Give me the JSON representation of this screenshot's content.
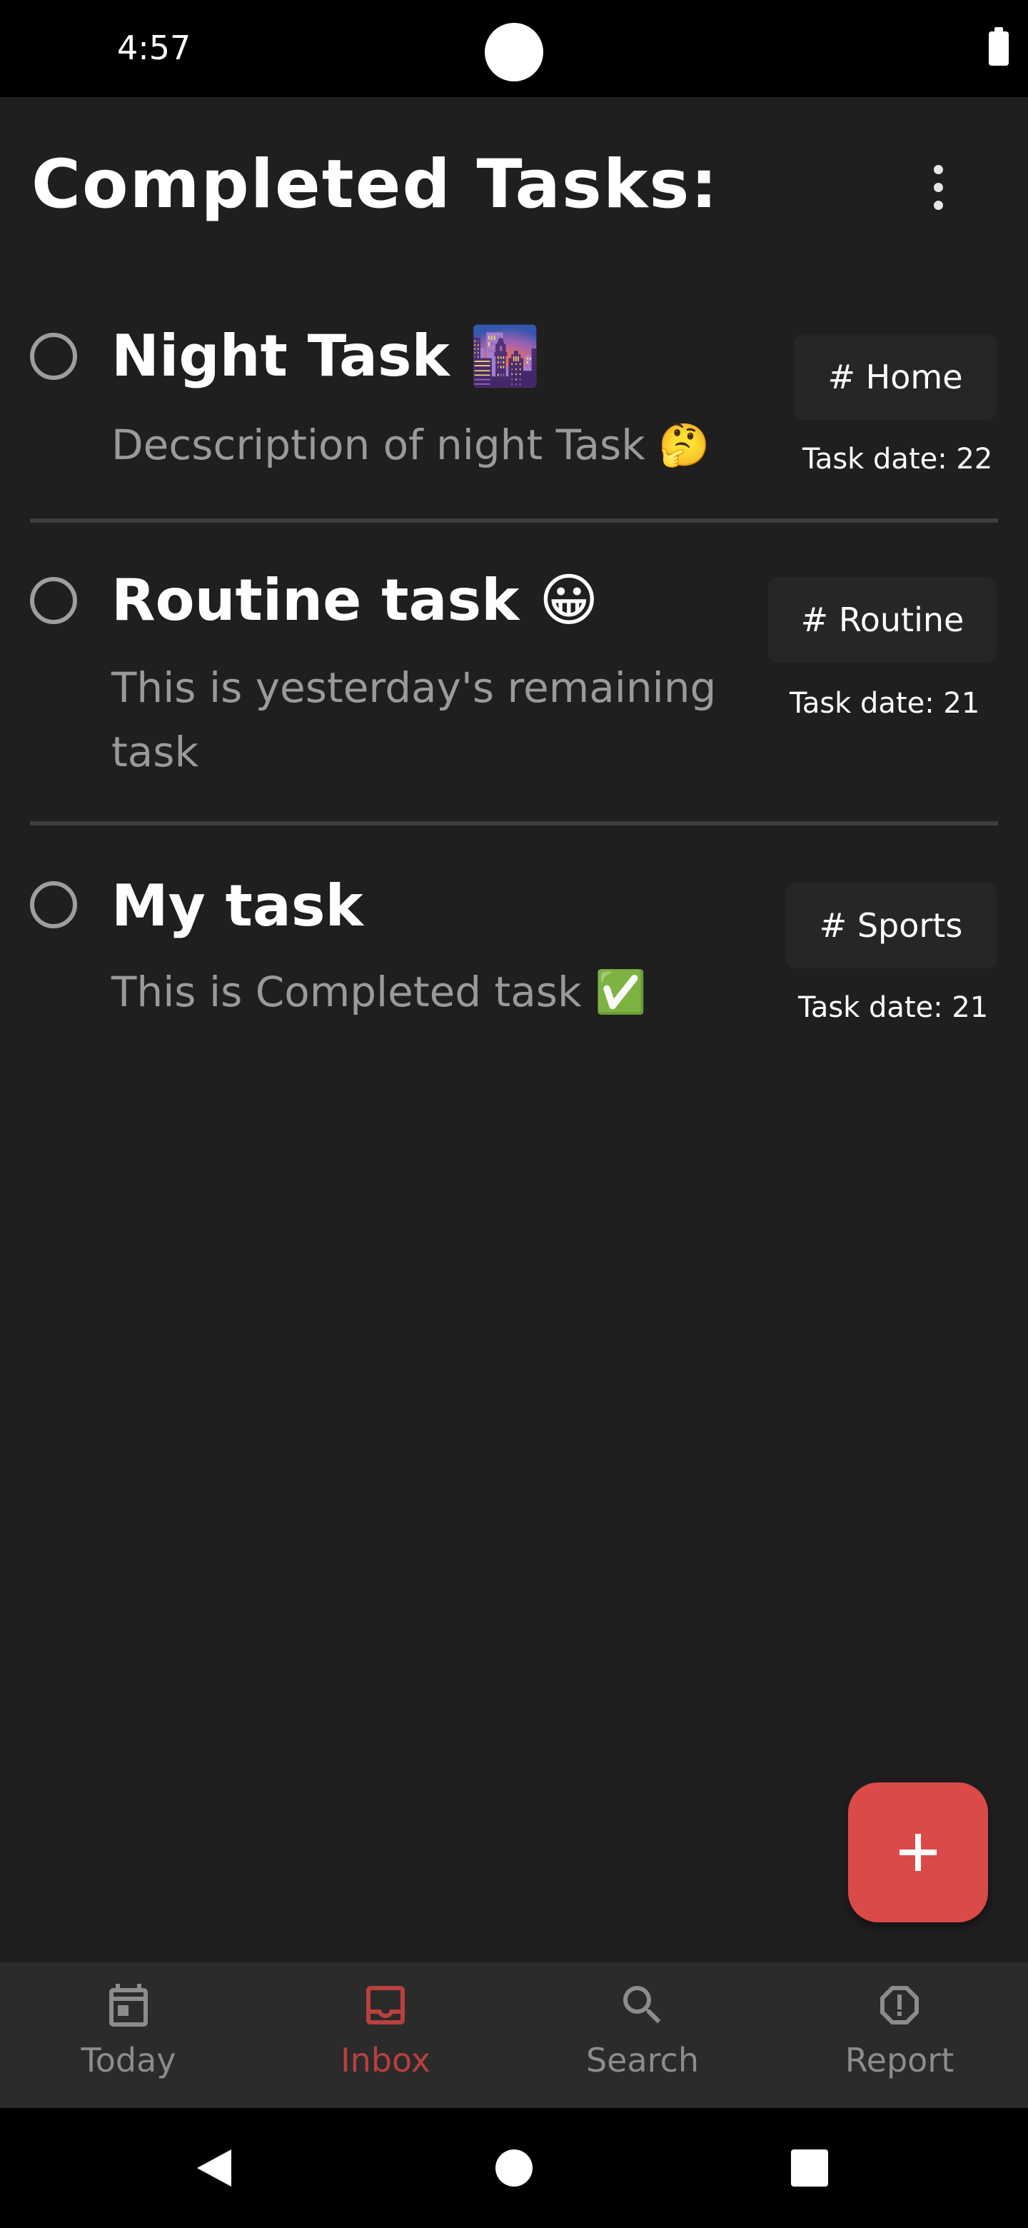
{
  "status_bar": {
    "time": "4:57"
  },
  "header": {
    "title": "Completed Tasks:",
    "more_icon": "more-vert-icon"
  },
  "tasks": [
    {
      "title": "Night Task 🌆",
      "description": "Decscription of night Task 🤔",
      "tag": "# Home",
      "date": "Task date: 22"
    },
    {
      "title": "Routine task 😀",
      "description": "This is yesterday's remaining task",
      "tag": "# Routine",
      "date": "Task date: 21"
    },
    {
      "title": "My task",
      "description": "This is Completed task ✅",
      "tag": "# Sports",
      "date": "Task date: 21"
    }
  ],
  "fab": {
    "icon": "plus-icon"
  },
  "bottom_nav": {
    "items": [
      {
        "label": "Today",
        "icon": "calendar-icon",
        "active": false
      },
      {
        "label": "Inbox",
        "icon": "inbox-icon",
        "active": true
      },
      {
        "label": "Search",
        "icon": "search-icon",
        "active": false
      },
      {
        "label": "Report",
        "icon": "report-icon",
        "active": false
      }
    ]
  },
  "colors": {
    "background": "#1f1f1f",
    "accent": "#d94a48",
    "active_nav": "#b8403f",
    "inactive_nav": "#8c8c8c",
    "tag_background": "#262626"
  }
}
